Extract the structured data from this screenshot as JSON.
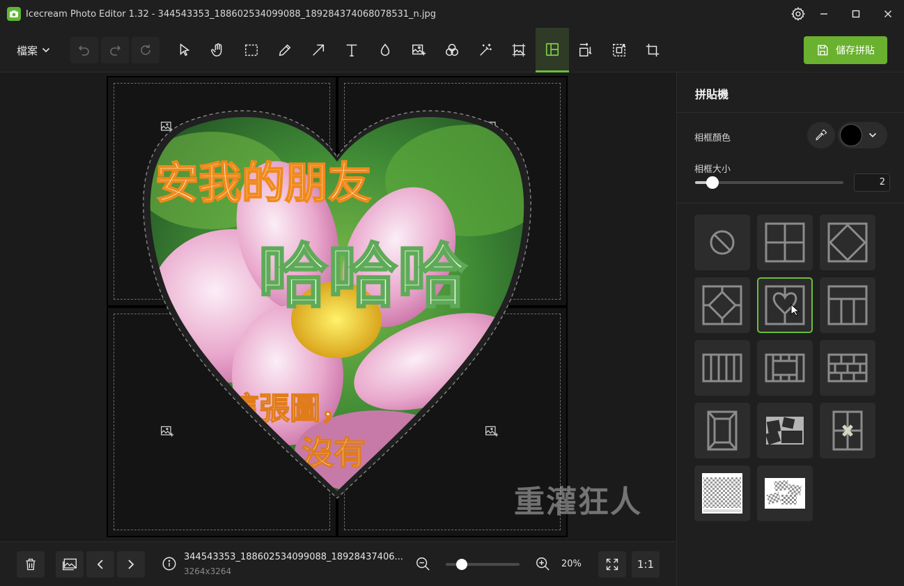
{
  "app": {
    "title": "Icecream Photo Editor 1.32 - 344543353_188602534099088_189284374068078531_n.jpg"
  },
  "toolbar": {
    "file_menu_label": "檔案",
    "save_button_label": "儲存拼貼",
    "tools": [
      "select-tool",
      "hand-tool",
      "rect-select-tool",
      "pencil-tool",
      "arrow-tool",
      "text-tool",
      "blur-tool",
      "add-image-tool",
      "filters-tool",
      "magic-tool",
      "resize-tool",
      "collage-tool",
      "rotate-tool",
      "fit-tool",
      "crop-tool"
    ],
    "active_tool": "collage-tool",
    "accent_color": "#69b12f"
  },
  "canvas": {
    "image_text": {
      "line1": "安我的朋友",
      "line2": "哈哈哈",
      "line3": "這張圖，",
      "line4": "沒有"
    },
    "watermark": "重灌狂人"
  },
  "bottom": {
    "file_name": "344543353_188602534099088_18928437406...",
    "file_dims": "3264x3264",
    "zoom_label": "20%",
    "zoom_level_fraction": 0.17,
    "one_to_one_label": "1:1"
  },
  "panel": {
    "title": "拼貼機",
    "frame_color_label": "相框顏色",
    "frame_color_value": "#000000",
    "frame_size_label": "相框大小",
    "frame_size_value": "2",
    "frame_size_fraction": 0.08,
    "layouts": [
      "no-layout",
      "grid-2x2",
      "diamond",
      "diamond-frame",
      "heart",
      "three-columns",
      "vertical-strips",
      "film-frame",
      "brick",
      "portrait-frame",
      "scattered-photos",
      "taped-photos",
      "transparent-single",
      "transparent-scatter"
    ],
    "selected_layout": "heart"
  }
}
